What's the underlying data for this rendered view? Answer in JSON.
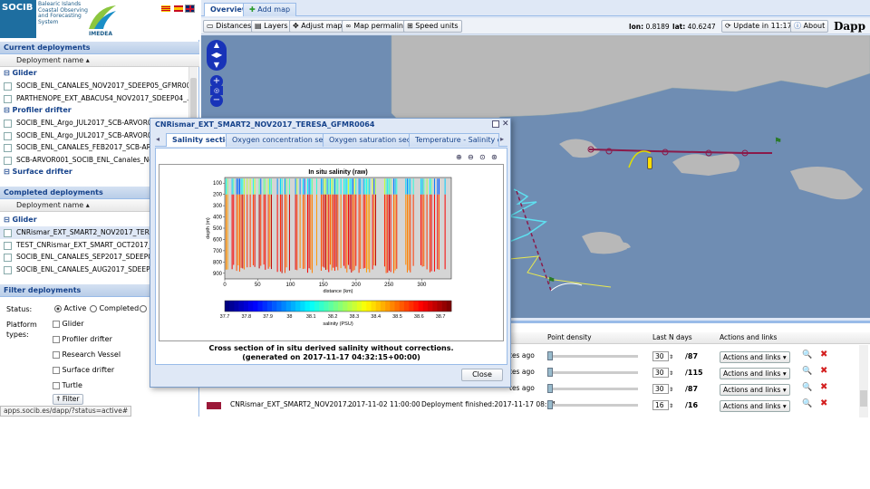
{
  "brand": {
    "logo": "SOCIB",
    "tag1": "Balearic Islands",
    "tag2": "Coastal Observing",
    "tag3": "and Forecasting",
    "tag4": "System",
    "partner": "IMEDEA"
  },
  "current": {
    "title": "Current deployments",
    "col": "Deployment name",
    "g1": "Glider",
    "glider": [
      "SOCIB_ENL_CANALES_NOV2017_SDEEP05_GFMR0065",
      "PARTHENOPE_EXT_ABACUS4_NOV2017_SDEEP04_..."
    ],
    "g2": "Profiler drifter",
    "profiler": [
      "SOCIB_ENL_Argo_JUL2017_SCB-ARVOR004",
      "SOCIB_ENL_Argo_JUL2017_SCB-ARVOR003",
      "SOCIB_ENL_CANALES_FEB2017_SCB-ARVOR",
      "SCB-ARVOR001_SOCIB_ENL_Canales_Nov2"
    ],
    "g3": "Surface drifter"
  },
  "completed": {
    "title": "Completed deployments",
    "col": "Deployment name",
    "g1": "Glider",
    "glider": [
      "CNRismar_EXT_SMART2_NOV2017_TERESA",
      "TEST_CNRismar_EXT_SMART_OCT2017_TE",
      "SOCIB_ENL_CANALES_SEP2017_SDEEP04_",
      "SOCIB_ENL_CANALES_AUG2017_SDEEP04_"
    ]
  },
  "filter": {
    "title": "Filter deployments",
    "status": "Status:",
    "active": "Active",
    "completed": "Completed",
    "ptype": "Platform",
    "ptype2": "types:",
    "types": [
      "Glider",
      "Profiler drifter",
      "Research Vessel",
      "Surface drifter",
      "Turtle"
    ],
    "btn": "Filter"
  },
  "statusbar": "apps.socib.es/dapp/?status=active#",
  "tabs": {
    "overview": "Overview",
    "add": "Add map"
  },
  "toolbar": {
    "distances": "Distances",
    "layers": "Layers",
    "adjust": "Adjust map",
    "permalink": "Map permalink",
    "speed": "Speed units",
    "lon_label": "lon:",
    "lon": "0.8189",
    "lat_label": "lat:",
    "lat": "40.6247",
    "update": "Update in 11:17",
    "about": "About",
    "app": "Dapp"
  },
  "modal": {
    "title": "CNRismar_EXT_SMART2_NOV2017_TERESA_GFMR0064",
    "tabs": [
      "Salinity section",
      "Oxygen concentration section",
      "Oxygen saturation section",
      "Temperature - Salinity diagram"
    ],
    "caption1": "Cross section of in situ derived salinity without corrections.",
    "caption2": "(generated on 2017-11-17 04:32:15+00:00)",
    "close": "Close"
  },
  "grid": {
    "cols": [
      "Point density",
      "Last N days",
      "Actions and links"
    ],
    "rows": [
      {
        "tail": "tes ago",
        "days": "30",
        "total": "/87",
        "action": "Actions and links"
      },
      {
        "tail": "tes ago",
        "days": "30",
        "total": "/115",
        "action": "Actions and links"
      },
      {
        "tail": "tes ago",
        "days": "30",
        "total": "/87",
        "action": "Actions and links"
      },
      {
        "name": "CNRismar_EXT_SMART2_NOV2017...",
        "date": "2017-11-02 11:00:00",
        "tail": "Deployment finished:2017-11-17 08:14...",
        "days": "16",
        "total": "/16",
        "action": "Actions and links",
        "color": "#9b1838"
      }
    ]
  },
  "chart_data": {
    "type": "heatmap",
    "title": "In situ salinity (raw)",
    "xlabel": "distance (km)",
    "ylabel": "depth (m)",
    "colorbar_label": "salinity (PSU)",
    "x_ticks": [
      0,
      50,
      100,
      150,
      200,
      250,
      300
    ],
    "y_ticks": [
      100,
      200,
      300,
      400,
      500,
      600,
      700,
      800,
      900
    ],
    "xlim": [
      0,
      345
    ],
    "ylim": [
      950,
      50
    ],
    "colorbar_ticks": [
      37.7,
      37.8,
      37.9,
      38,
      38.1,
      38.2,
      38.3,
      38.4,
      38.5,
      38.6,
      38.7
    ],
    "clim": [
      37.7,
      38.75
    ],
    "colormap": "jet"
  }
}
